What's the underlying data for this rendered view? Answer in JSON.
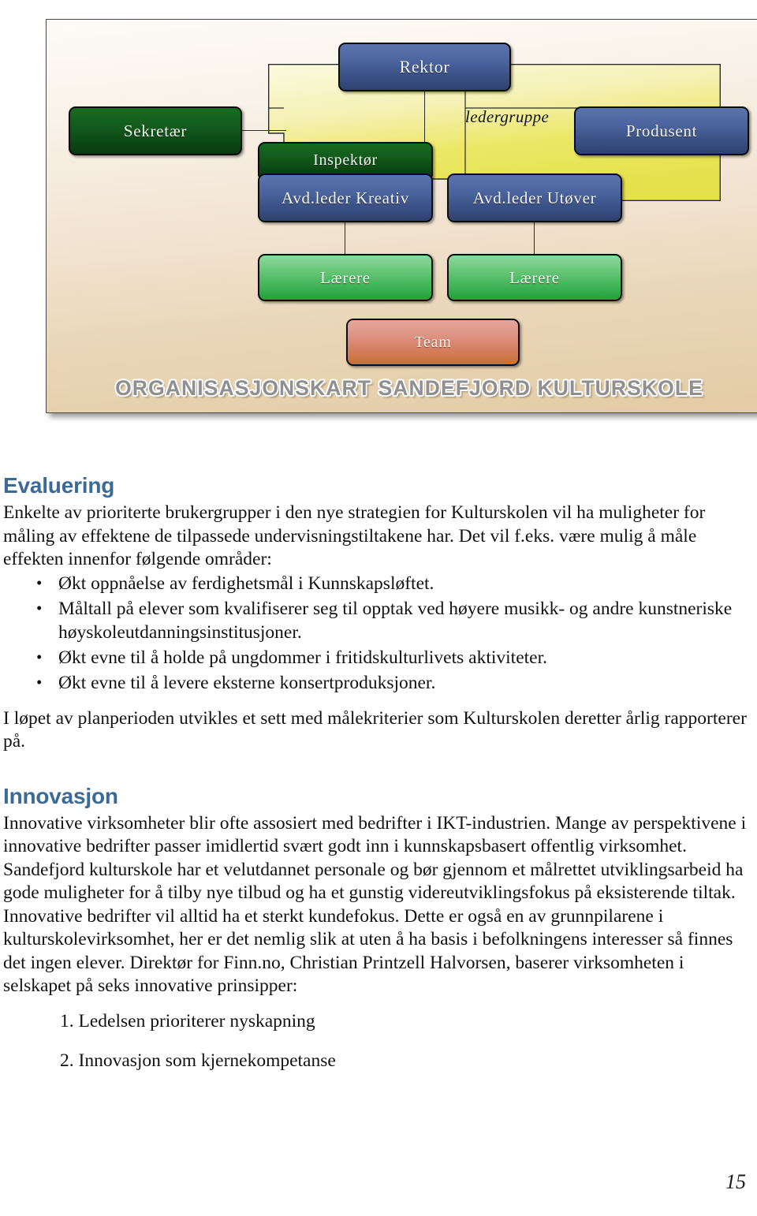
{
  "org_chart": {
    "caption": "ORGANISASJONSKART SANDEFJORD KULTURSKOLE",
    "group_label": "ledergruppe",
    "nodes": {
      "rektor": "Rektor",
      "sekretar": "Sekretær",
      "produsent": "Produsent",
      "inspektor": "Inspektør",
      "avd_leder_kreativ": "Avd.leder Kreativ",
      "avd_leder_utover": "Avd.leder Utøver",
      "larere_kreativ": "Lærere",
      "larere_utover": "Lærere",
      "team": "Team"
    },
    "colors": {
      "blue": "#4c65a0",
      "dark_green": "#12591b",
      "light_green": "#3fb356",
      "salmon": "#d47d5c",
      "ledergruppe_yellow": "#ece95e",
      "background": "#e9d5b5",
      "caption_text": "#8f8f8f"
    }
  },
  "sections": [
    {
      "heading": "Evaluering",
      "intro": "Enkelte av prioriterte brukergrupper i den nye strategien for Kulturskolen vil ha muligheter for måling av effektene de tilpassede undervisningstiltakene har. Det vil f.eks. være mulig å måle effekten innenfor følgende områder:",
      "bullets": [
        "Økt oppnåelse av ferdighetsmål i Kunnskapsløftet.",
        "Måltall på elever som kvalifiserer seg til opptak ved høyere musikk- og andre kunstneriske høyskoleutdanningsinstitusjoner.",
        "Økt evne til å holde på ungdommer i fritidskulturlivets aktiviteter.",
        "Økt evne til å levere eksterne konsertproduksjoner."
      ],
      "closing": "I løpet av planperioden utvikles et sett med målekriterier som Kulturskolen deretter årlig rapporterer på."
    },
    {
      "heading": "Innovasjon",
      "intro": "Innovative virksomheter blir ofte assosiert med bedrifter i IKT-industrien. Mange av perspektivene i innovative bedrifter passer imidlertid svært godt inn i kunnskapsbasert offentlig virksomhet. Sandefjord kulturskole har et velutdannet personale og bør gjennom et målrettet utviklingsarbeid ha gode muligheter for å tilby nye tilbud og ha et gunstig videreutviklingsfokus på eksisterende tiltak. Innovative bedrifter vil alltid ha et sterkt kundefokus. Dette er også en av grunnpilarene i kulturskolevirksomhet, her er det nemlig slik at uten å ha basis i befolkningens interesser så finnes det ingen elever. Direktør for Finn.no, Christian Printzell Halvorsen, baserer virksomheten i selskapet på seks innovative prinsipper:",
      "principles": [
        "1. Ledelsen prioriterer nyskapning",
        "2. Innovasjon som kjernekompetanse"
      ]
    }
  ],
  "footer": {
    "page_number": "15"
  },
  "theme": {
    "heading_color": "#3a6a96",
    "body_color": "#121212"
  }
}
